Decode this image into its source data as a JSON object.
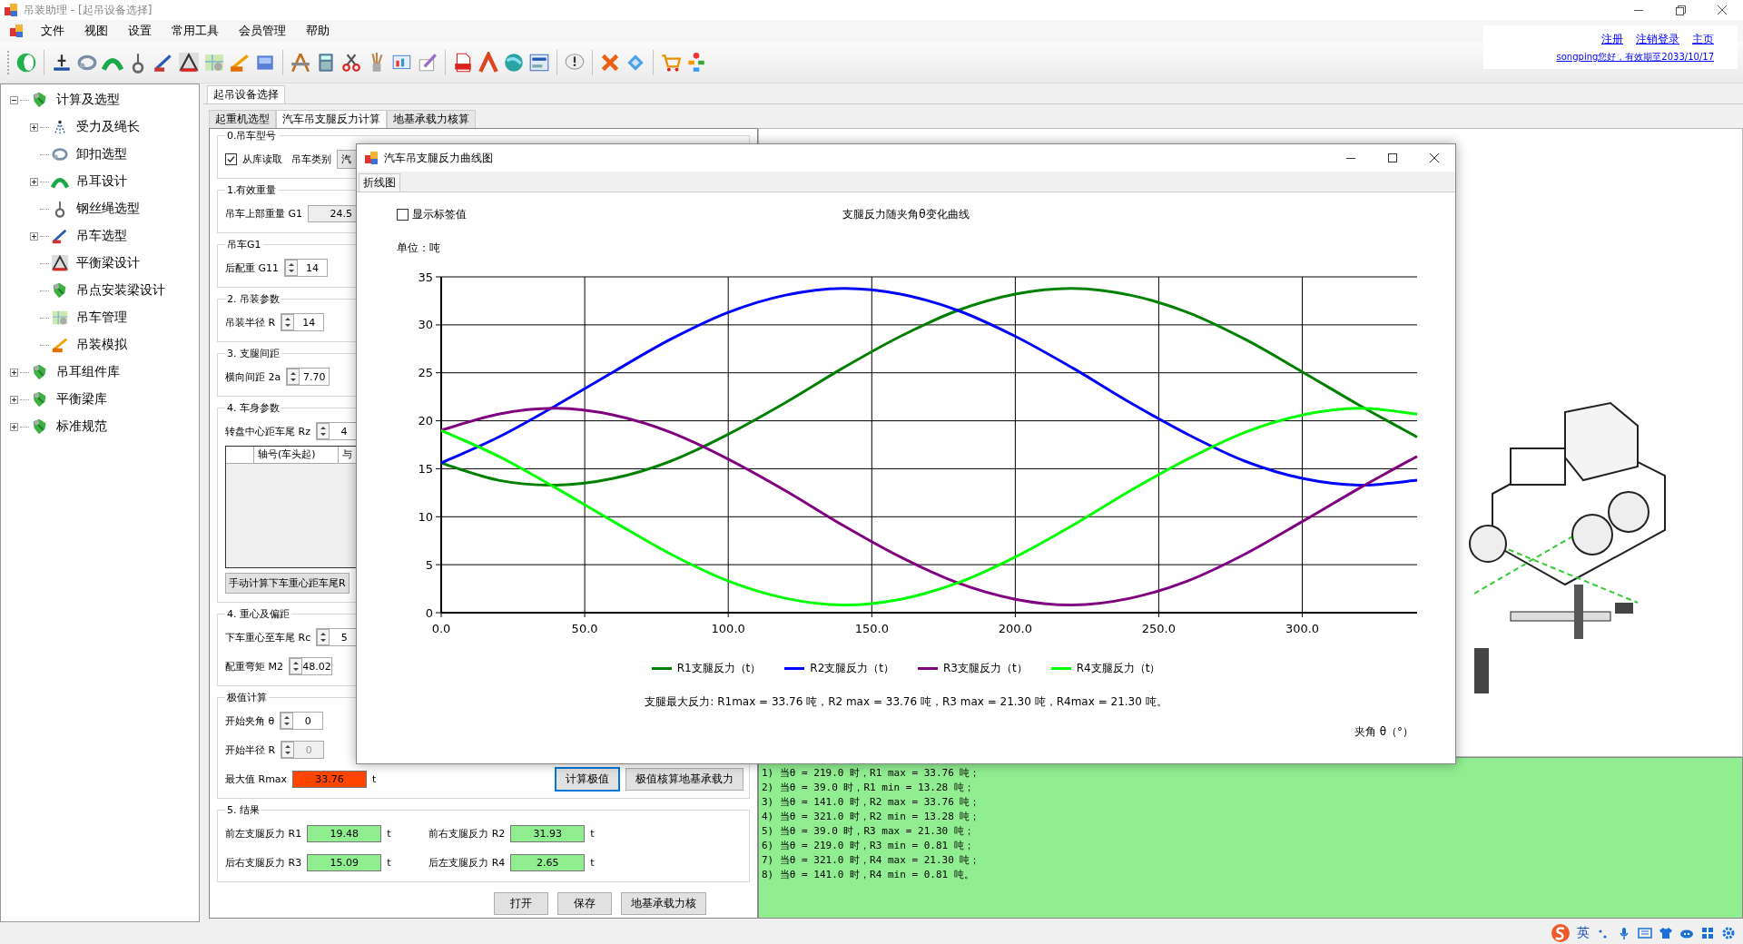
{
  "window": {
    "title": "吊装助理 - [起吊设备选择]"
  },
  "menu": [
    "文件",
    "视图",
    "设置",
    "常用工具",
    "会员管理",
    "帮助"
  ],
  "account": {
    "links": [
      "注册",
      "注销登录",
      "主页"
    ],
    "greeting": "songping您好，有效期至2033/10/17"
  },
  "tree": [
    {
      "label": "计算及选型",
      "kind": "library",
      "expanded": true,
      "children": [
        {
          "label": "受力及绳长",
          "kind": "force",
          "expanded": false
        },
        {
          "label": "卸扣选型",
          "kind": "shackle"
        },
        {
          "label": "吊耳设计",
          "kind": "lug",
          "expanded": false
        },
        {
          "label": "钢丝绳选型",
          "kind": "rope"
        },
        {
          "label": "吊车选型",
          "kind": "crane",
          "expanded": false
        },
        {
          "label": "平衡梁设计",
          "kind": "beam"
        },
        {
          "label": "吊点安装梁设计",
          "kind": "library"
        },
        {
          "label": "吊车管理",
          "kind": "map"
        },
        {
          "label": "吊装模拟",
          "kind": "simulate"
        }
      ]
    },
    {
      "label": "吊耳组件库",
      "kind": "library",
      "expanded": false
    },
    {
      "label": "平衡梁库",
      "kind": "library",
      "expanded": false
    },
    {
      "label": "标准规范",
      "kind": "library",
      "expanded": false
    }
  ],
  "doc_tabs": [
    {
      "label": "起吊设备选择",
      "selected": true
    }
  ],
  "sub_tabs": [
    {
      "label": "起重机选型",
      "selected": false
    },
    {
      "label": "汽车吊支腿反力计算",
      "selected": true
    },
    {
      "label": "地基承载力核算",
      "selected": false
    }
  ],
  "form": {
    "groups": [
      {
        "title": "0.吊车型号",
        "rows": [
          {
            "items": [
              {
                "kind": "check",
                "label": "从库读取",
                "checked": true
              },
              {
                "kind": "label",
                "text": "吊车类别"
              },
              {
                "kind": "combo",
                "value": "汽"
              }
            ]
          }
        ]
      },
      {
        "title": "1.有效重量",
        "rows": [
          {
            "items": [
              {
                "kind": "label",
                "text": "吊车上部重量 G1"
              },
              {
                "kind": "field",
                "value": "24.5"
              }
            ]
          }
        ]
      },
      {
        "title": "吊车G1",
        "rows": [
          {
            "items": [
              {
                "kind": "label",
                "text": "后配重 G11"
              },
              {
                "kind": "spinner",
                "value": "14",
                "disabled": false
              }
            ]
          }
        ]
      },
      {
        "title": "2. 吊装参数",
        "rows": [
          {
            "items": [
              {
                "kind": "label",
                "text": "吊装半径 R"
              },
              {
                "kind": "spinner",
                "value": "14",
                "disabled": false
              }
            ]
          }
        ]
      },
      {
        "title": "3. 支腿间距",
        "rows": [
          {
            "items": [
              {
                "kind": "label",
                "text": "横向间距 2a"
              },
              {
                "kind": "spinner",
                "value": "7.70",
                "disabled": false
              }
            ]
          }
        ]
      },
      {
        "title": "4. 车身参数",
        "rows": [
          {
            "items": [
              {
                "kind": "label",
                "text": "转盘中心距车尾 Rz"
              },
              {
                "kind": "spinner",
                "value": "4",
                "disabled": false
              }
            ]
          },
          {
            "items": [
              {
                "kind": "table",
                "columns": [
                  "轴号(车头起)",
                  "与"
                ]
              }
            ]
          },
          {
            "items": [
              {
                "kind": "button",
                "label": "手动计算下车重心距车尾R",
                "focused": false
              }
            ]
          }
        ]
      },
      {
        "title": "4. 重心及偏距",
        "rows": [
          {
            "items": [
              {
                "kind": "label",
                "text": "下车重心至车尾 Rc"
              },
              {
                "kind": "spinner",
                "value": "5",
                "disabled": false
              }
            ]
          },
          {
            "items": [
              {
                "kind": "label",
                "text": "配重弯矩 M2"
              },
              {
                "kind": "spinner",
                "value": "48.02",
                "disabled": false
              }
            ]
          }
        ]
      },
      {
        "title": "极值计算",
        "rows": [
          {
            "items": [
              {
                "kind": "label",
                "text": "开始夹角 θ"
              },
              {
                "kind": "spinner",
                "value": "0",
                "disabled": false
              }
            ]
          },
          {
            "items": [
              {
                "kind": "label",
                "text": "开始半径 R"
              },
              {
                "kind": "spinner",
                "value": "0",
                "disabled": true
              }
            ]
          },
          {
            "items": [
              {
                "kind": "label",
                "text": "最大值 Rmax"
              },
              {
                "kind": "output",
                "value": "33.76",
                "color": "#ff4500"
              },
              {
                "kind": "unit",
                "text": "t"
              },
              {
                "kind": "button",
                "label": "计算极值",
                "focused": true
              },
              {
                "kind": "button",
                "label": "极值核算地基承载力",
                "focused": false
              }
            ]
          }
        ]
      },
      {
        "title": "5. 结果",
        "rows": [
          {
            "items": [
              {
                "kind": "label",
                "text": "前左支腿反力 R1"
              },
              {
                "kind": "output",
                "value": "19.48",
                "color": "#90ee90"
              },
              {
                "kind": "unit",
                "text": "t"
              },
              {
                "kind": "label",
                "text": "前右支腿反力 R2"
              },
              {
                "kind": "output",
                "value": "31.93",
                "color": "#90ee90"
              },
              {
                "kind": "unit",
                "text": "t"
              }
            ]
          },
          {
            "items": [
              {
                "kind": "label",
                "text": "后右支腿反力 R3"
              },
              {
                "kind": "output",
                "value": "15.09",
                "color": "#90ee90"
              },
              {
                "kind": "unit",
                "text": "t"
              },
              {
                "kind": "label",
                "text": "后左支腿反力 R4"
              },
              {
                "kind": "output",
                "value": "2.65",
                "color": "#90ee90"
              },
              {
                "kind": "unit",
                "text": "t"
              }
            ]
          }
        ]
      }
    ],
    "buttons": [
      {
        "label": "打开",
        "focused": false
      },
      {
        "label": "保存",
        "focused": false
      },
      {
        "label": "地基承载力核",
        "focused": false
      }
    ]
  },
  "log": [
    "1) 当θ = 219.0 时，R1 max = 33.76 吨；",
    "2) 当θ = 39.0 时，R1 min = 13.28 吨；",
    "3) 当θ = 141.0 时，R2 max = 33.76 吨；",
    "4) 当θ = 321.0 时，R2 min = 13.28 吨；",
    "5) 当θ = 39.0 时，R3 max = 21.30 吨；",
    "6) 当θ = 219.0 时，R3 min = 0.81 吨；",
    "7) 当θ = 321.0 时，R4 max = 21.30 吨；",
    "8) 当θ = 141.0 时，R4 min = 0.81 吨。"
  ],
  "dialog": {
    "title": "汽车吊支腿反力曲线图",
    "tabs": [
      {
        "label": "折线图",
        "selected": true
      }
    ],
    "show_labels": {
      "label": "显示标签值",
      "checked": false
    },
    "chart_data": {
      "type": "line",
      "title": "支腿反力随夹角θ变化曲线",
      "ylabel": "单位：吨",
      "xlabel": "夹角 θ（°）",
      "x": [
        0,
        20,
        40,
        60,
        80,
        100,
        120,
        140,
        160,
        180,
        200,
        220,
        240,
        260,
        280,
        300,
        320,
        340
      ],
      "series": [
        {
          "name": "R1支腿反力（t）",
          "color": "#008000",
          "values": [
            15.6,
            13.8,
            13.3,
            14,
            15.8,
            18.6,
            21.9,
            25.5,
            28.8,
            31.5,
            33.2,
            33.8,
            33.1,
            31.3,
            28.5,
            25.1,
            21.6,
            18.3
          ]
        },
        {
          "name": "R2支腿反力（t）",
          "color": "#0000ff",
          "values": [
            15.6,
            18.3,
            21.6,
            25.1,
            28.5,
            31.3,
            33.1,
            33.8,
            33.2,
            31.5,
            28.8,
            25.5,
            21.9,
            18.6,
            15.8,
            14,
            13.3,
            13.8
          ]
        },
        {
          "name": "R3支腿反力（t）",
          "color": "#800080",
          "values": [
            19,
            20.7,
            21.3,
            20.6,
            18.8,
            16,
            12.7,
            9.1,
            5.8,
            3.1,
            1.4,
            0.8,
            1.5,
            3.3,
            6.1,
            9.5,
            13,
            16.3
          ]
        },
        {
          "name": "R4支腿反力（t）",
          "color": "#00ff00",
          "values": [
            19,
            16.3,
            13,
            9.5,
            6.1,
            3.3,
            1.5,
            0.8,
            1.4,
            3.1,
            5.8,
            9.1,
            12.7,
            16,
            18.8,
            20.6,
            21.3,
            20.7
          ]
        }
      ],
      "grid": true,
      "xlim": [
        0,
        340
      ],
      "ylim": [
        0,
        35
      ],
      "xticks": [
        {
          "value": 0,
          "label": "0.0"
        },
        {
          "value": 50,
          "label": "50.0"
        },
        {
          "value": 100,
          "label": "100.0"
        },
        {
          "value": 150,
          "label": "150.0"
        },
        {
          "value": 200,
          "label": "200.0"
        },
        {
          "value": 250,
          "label": "250.0"
        },
        {
          "value": 300,
          "label": "300.0"
        }
      ],
      "yticks": [
        0,
        5,
        10,
        15,
        20,
        25,
        30,
        35
      ]
    },
    "summary": "支腿最大反力: R1max = 33.76 吨，R2 max = 33.76 吨，R3 max = 21.30 吨，R4max = 21.30 吨。"
  },
  "ime": {
    "mode": "英"
  }
}
